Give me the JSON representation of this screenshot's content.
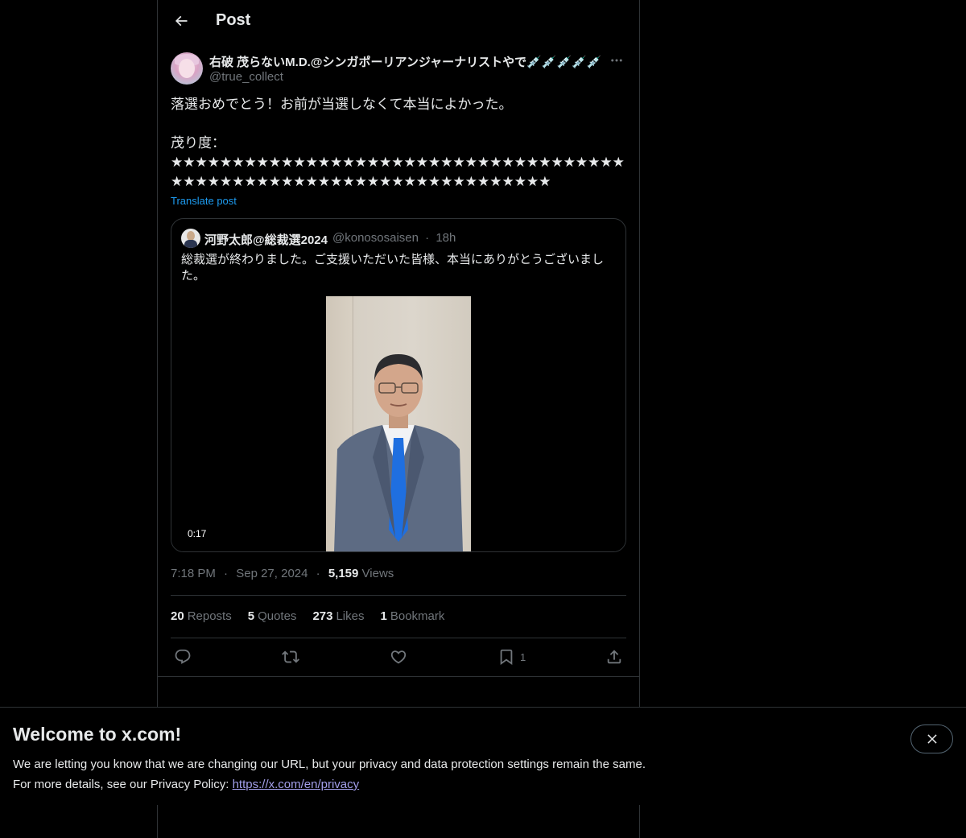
{
  "header": {
    "title": "Post",
    "back_icon": "arrow-left-icon"
  },
  "post": {
    "display_name": "右破 茂らないM.D.@シンガポーリアンジャーナリストやで💉💉💉💉💉",
    "username": "@true_collect",
    "text": "落選おめでとう！お前が当選しなくて本当によかった。\n\n茂り度：\n★★★★★★★★★★★★★★★★★★★★★★★★★★★★★★★★★★★★★★★★★★★★★★★★★★★★★★★★★★★★★★★★★★★★",
    "translate_label": "Translate post",
    "more_icon": "more-horizontal-icon"
  },
  "quote": {
    "name": "河野太郎@総裁選2024",
    "handle": "@konososaisen",
    "separator": "·",
    "time": "18h",
    "text": "総裁選が終わりました。ご支援いただいた皆様、本当にありがとうございました。",
    "video_duration": "0:17"
  },
  "meta": {
    "time": "7:18 PM",
    "separator": "·",
    "date": "Sep 27, 2024",
    "views_count": "5,159",
    "views_label": "Views"
  },
  "stats": {
    "reposts_count": "20",
    "reposts_label": "Reposts",
    "quotes_count": "5",
    "quotes_label": "Quotes",
    "likes_count": "273",
    "likes_label": "Likes",
    "bookmarks_count": "1",
    "bookmarks_label": "Bookmark"
  },
  "actions": {
    "reply_icon": "reply-icon",
    "repost_icon": "repost-icon",
    "like_icon": "heart-icon",
    "bookmark_icon": "bookmark-icon",
    "bookmark_count": "1",
    "share_icon": "share-icon"
  },
  "banner": {
    "title": "Welcome to x.com!",
    "line1": "We are letting you know that we are changing our URL, but your privacy and data protection settings remain the same.",
    "line2_prefix": "For more details, see our Privacy Policy: ",
    "link": "https://x.com/en/privacy",
    "close_icon": "close-icon"
  },
  "colors": {
    "background": "#000000",
    "text": "#e7e9ea",
    "secondary_text": "#71767b",
    "accent": "#1d9bf0",
    "border": "#2f3336",
    "link": "#a29ee9"
  }
}
